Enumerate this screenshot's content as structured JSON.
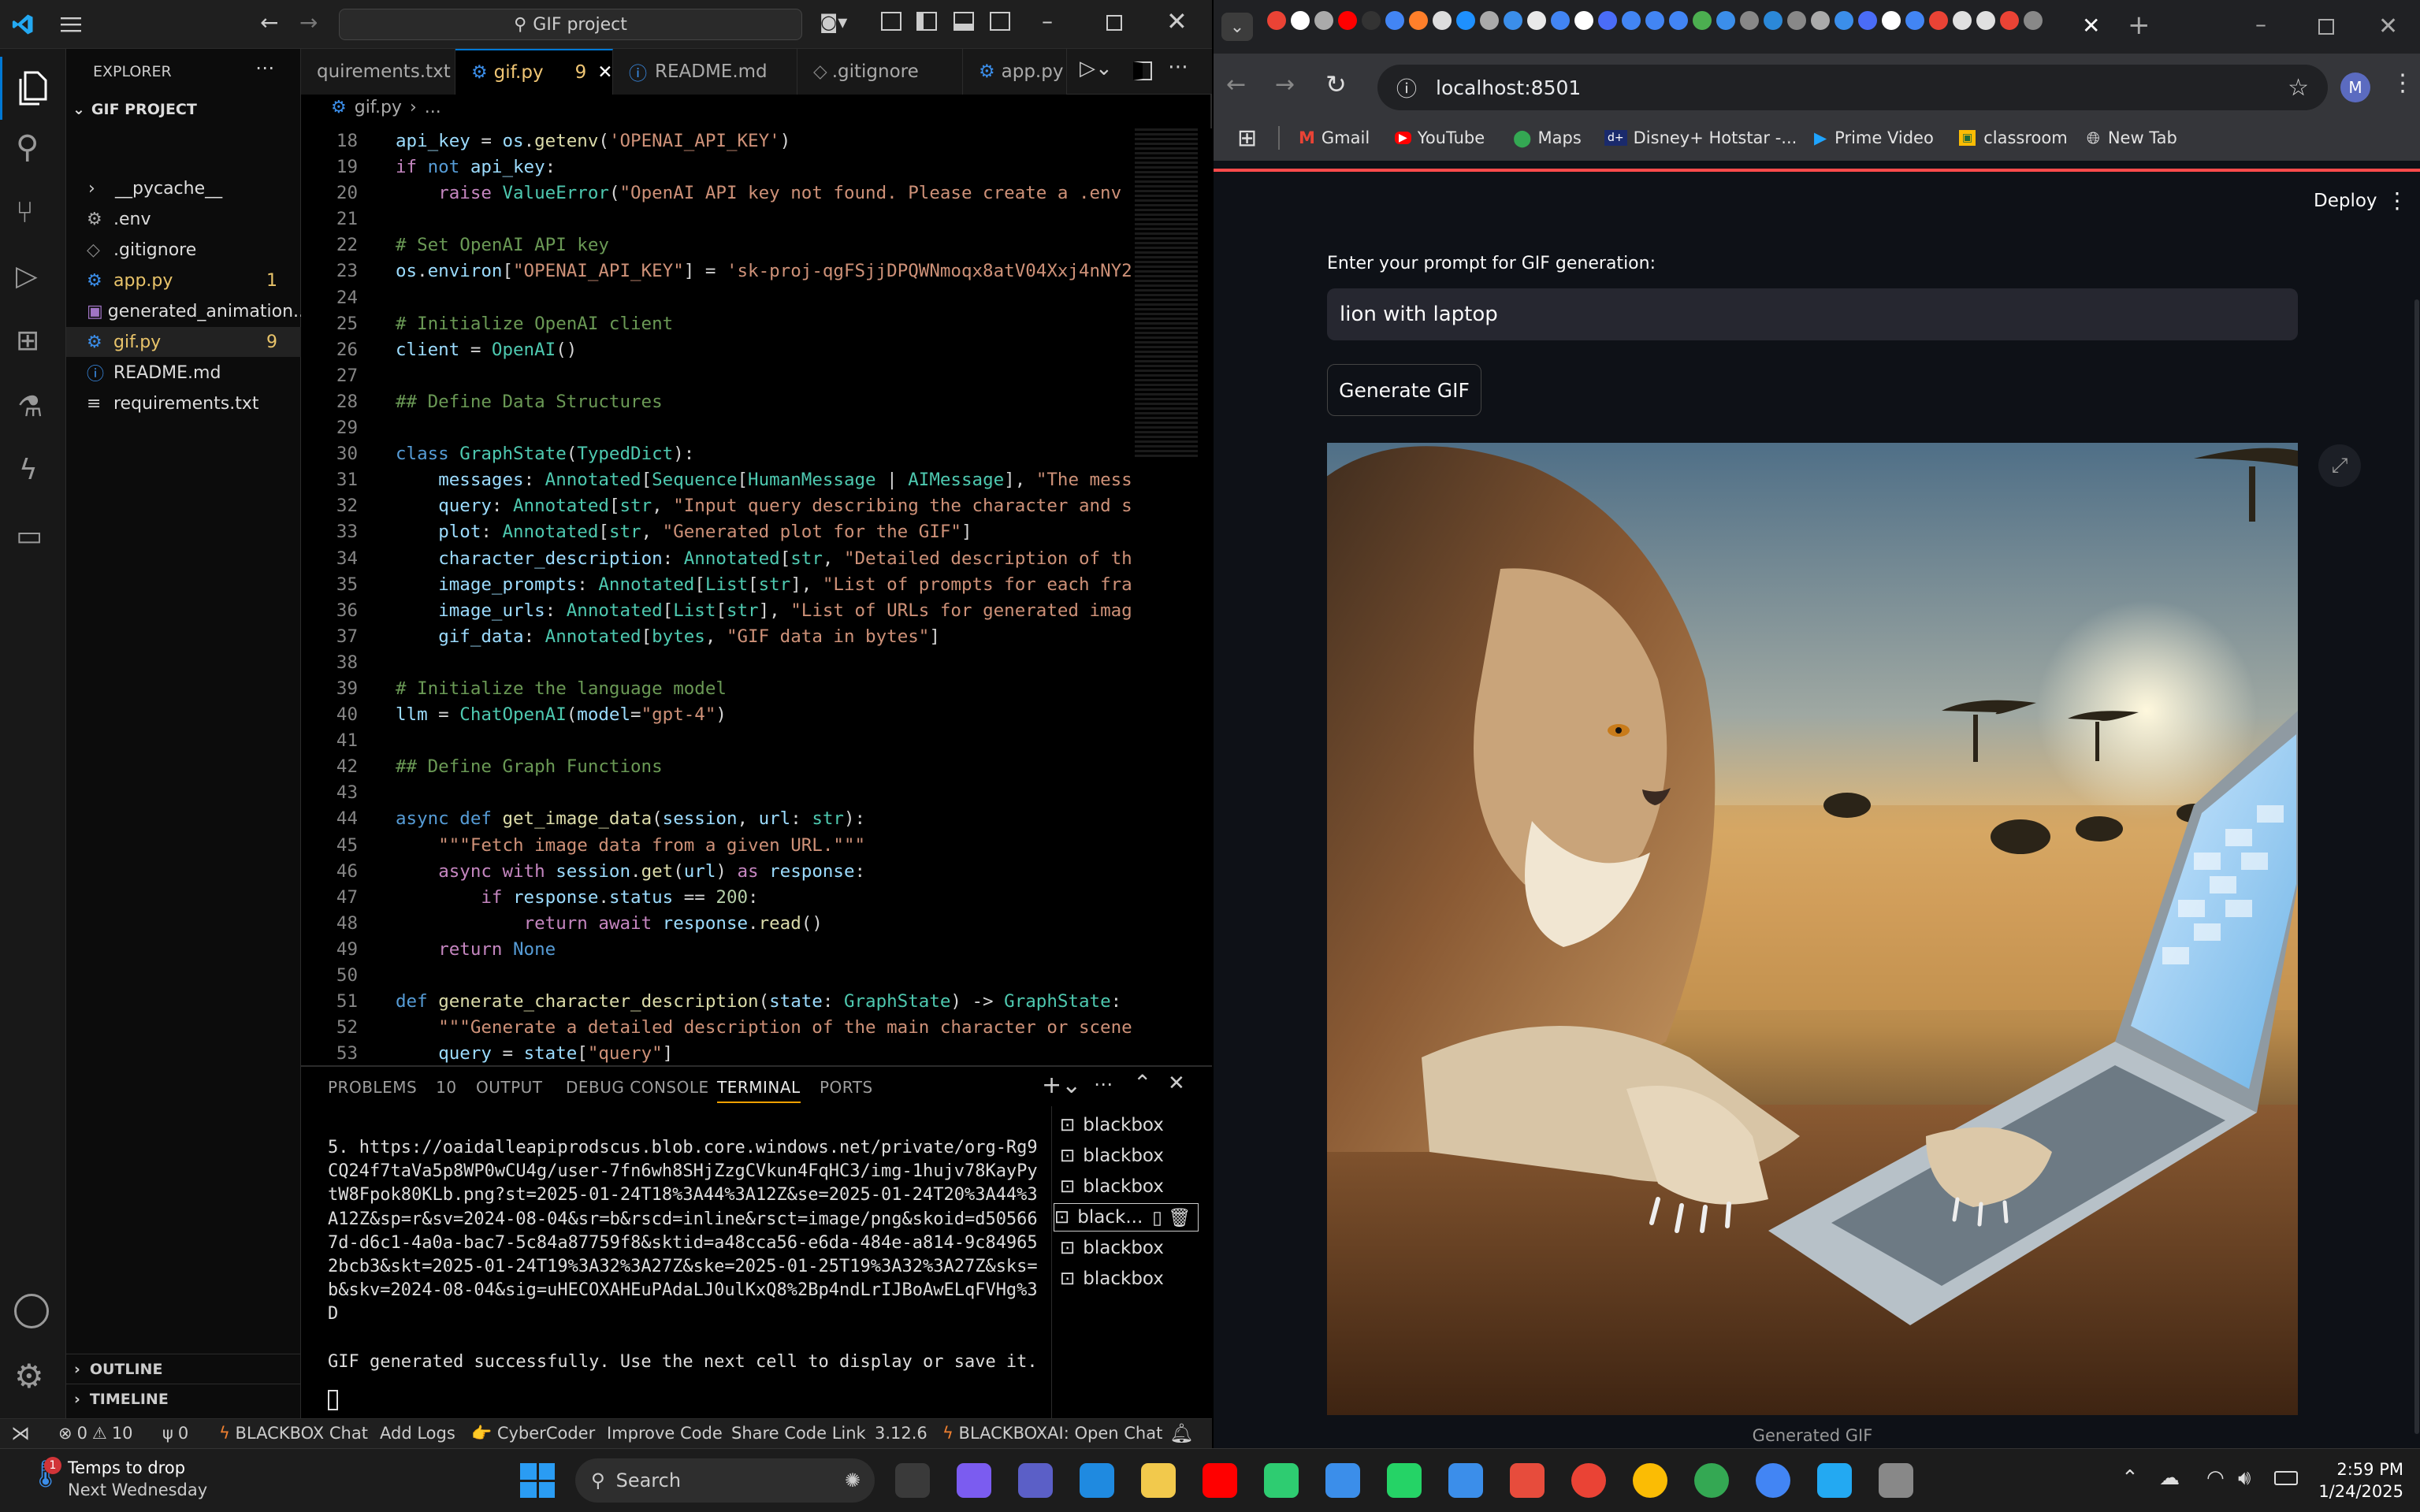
{
  "vscode": {
    "search_placeholder": "GIF project",
    "tabs": [
      {
        "label": "quirements.txt",
        "badge": "",
        "active": false
      },
      {
        "label": "gif.py",
        "badge": "9",
        "active": true
      },
      {
        "label": "README.md",
        "badge": "",
        "active": false
      },
      {
        "label": ".gitignore",
        "badge": "",
        "active": false
      },
      {
        "label": "app.py",
        "badge": "",
        "active": false
      }
    ],
    "breadcrumb": {
      "file": "gif.py",
      "rest": "..."
    },
    "explorer": {
      "title": "EXPLORER",
      "project": "GIF PROJECT",
      "items": [
        {
          "name": "__pycache__",
          "badge": "",
          "type": "folder"
        },
        {
          "name": ".env",
          "badge": "",
          "type": "gear"
        },
        {
          "name": ".gitignore",
          "badge": "",
          "type": "file"
        },
        {
          "name": "app.py",
          "badge": "1",
          "type": "py"
        },
        {
          "name": "generated_animation....",
          "badge": "",
          "type": "img"
        },
        {
          "name": "gif.py",
          "badge": "9",
          "type": "py"
        },
        {
          "name": "README.md",
          "badge": "",
          "type": "info"
        },
        {
          "name": "requirements.txt",
          "badge": "",
          "type": "txt"
        }
      ],
      "outline": "OUTLINE",
      "timeline": "TIMELINE"
    },
    "code_lines": [
      {
        "n": "18",
        "html": "<span class='var'>api_key</span> = <span class='var'>os</span>.<span class='fn'>getenv</span>(<span class='str'>'OPENAI_API_KEY'</span>)"
      },
      {
        "n": "19",
        "html": "<span class='ctl'>if</span> <span class='kw'>not</span> <span class='var'>api_key</span>:"
      },
      {
        "n": "20",
        "html": "    <span class='ctl'>raise</span> <span class='cls'>ValueError</span>(<span class='str'>\"OpenAI API key not found. Please create a .env</span>"
      },
      {
        "n": "21",
        "html": ""
      },
      {
        "n": "22",
        "html": "<span class='cm'># Set OpenAI API key</span>"
      },
      {
        "n": "23",
        "html": "<span class='var'>os</span>.<span class='var'>environ</span>[<span class='str'>\"OPENAI_API_KEY\"</span>] = <span class='str'>'sk-proj-qgFSjjDPQWNmoqx8atV04Xxj4nNY2</span>"
      },
      {
        "n": "24",
        "html": ""
      },
      {
        "n": "25",
        "html": "<span class='cm'># Initialize OpenAI client</span>"
      },
      {
        "n": "26",
        "html": "<span class='var'>client</span> = <span class='cls'>OpenAI</span>()"
      },
      {
        "n": "27",
        "html": ""
      },
      {
        "n": "28",
        "html": "<span class='cm'>## Define Data Structures</span>"
      },
      {
        "n": "29",
        "html": ""
      },
      {
        "n": "30",
        "html": "<span class='kw'>class</span> <span class='cls'>GraphState</span>(<span class='cls'>TypedDict</span>):"
      },
      {
        "n": "31",
        "html": "    <span class='var'>messages</span>: <span class='cls'>Annotated</span>[<span class='cls'>Sequence</span>[<span class='cls'>HumanMessage</span> | <span class='cls'>AIMessage</span>], <span class='str'>\"The mess</span>"
      },
      {
        "n": "32",
        "html": "    <span class='var'>query</span>: <span class='cls'>Annotated</span>[<span class='cls'>str</span>, <span class='str'>\"Input query describing the character and s</span>"
      },
      {
        "n": "33",
        "html": "    <span class='var'>plot</span>: <span class='cls'>Annotated</span>[<span class='cls'>str</span>, <span class='str'>\"Generated plot for the GIF\"</span>]"
      },
      {
        "n": "34",
        "html": "    <span class='var'>character_description</span>: <span class='cls'>Annotated</span>[<span class='cls'>str</span>, <span class='str'>\"Detailed description of th</span>"
      },
      {
        "n": "35",
        "html": "    <span class='var'>image_prompts</span>: <span class='cls'>Annotated</span>[<span class='cls'>List</span>[<span class='cls'>str</span>], <span class='str'>\"List of prompts for each fra</span>"
      },
      {
        "n": "36",
        "html": "    <span class='var'>image_urls</span>: <span class='cls'>Annotated</span>[<span class='cls'>List</span>[<span class='cls'>str</span>], <span class='str'>\"List of URLs for generated imag</span>"
      },
      {
        "n": "37",
        "html": "    <span class='var'>gif_data</span>: <span class='cls'>Annotated</span>[<span class='cls'>bytes</span>, <span class='str'>\"GIF data in bytes\"</span>]"
      },
      {
        "n": "38",
        "html": ""
      },
      {
        "n": "39",
        "html": "<span class='cm'># Initialize the language model</span>"
      },
      {
        "n": "40",
        "html": "<span class='var'>llm</span> = <span class='cls'>ChatOpenAI</span>(<span class='var'>model</span>=<span class='str'>\"gpt-4\"</span>)"
      },
      {
        "n": "41",
        "html": ""
      },
      {
        "n": "42",
        "html": "<span class='cm'>## Define Graph Functions</span>"
      },
      {
        "n": "43",
        "html": ""
      },
      {
        "n": "44",
        "html": "<span class='kw'>async</span> <span class='kw'>def</span> <span class='fn'>get_image_data</span>(<span class='var'>session</span>, <span class='var'>url</span>: <span class='cls'>str</span>):"
      },
      {
        "n": "45",
        "html": "    <span class='str'>\"\"\"Fetch image data from a given URL.\"\"\"</span>"
      },
      {
        "n": "46",
        "html": "    <span class='ctl'>async</span> <span class='ctl'>with</span> <span class='var'>session</span>.<span class='fn'>get</span>(<span class='var'>url</span>) <span class='ctl'>as</span> <span class='var'>response</span>:"
      },
      {
        "n": "47",
        "html": "        <span class='ctl'>if</span> <span class='var'>response</span>.<span class='var'>status</span> == <span class='num'>200</span>:"
      },
      {
        "n": "48",
        "html": "            <span class='ctl'>return</span> <span class='ctl'>await</span> <span class='var'>response</span>.<span class='fn'>read</span>()"
      },
      {
        "n": "49",
        "html": "    <span class='ctl'>return</span> <span class='kw'>None</span>"
      },
      {
        "n": "50",
        "html": ""
      },
      {
        "n": "51",
        "html": "<span class='kw'>def</span> <span class='fn'>generate_character_description</span>(<span class='var'>state</span>: <span class='cls'>GraphState</span>) -> <span class='cls'>GraphState</span>:"
      },
      {
        "n": "52",
        "html": "    <span class='str'>\"\"\"Generate a detailed description of the main character or scene</span>"
      },
      {
        "n": "53",
        "html": "    <span class='var'>query</span> = <span class='var'>state</span>[<span class='str'>\"query\"</span>]"
      }
    ],
    "panel": {
      "tabs": [
        "PROBLEMS",
        "OUTPUT",
        "DEBUG CONSOLE",
        "TERMINAL",
        "PORTS"
      ],
      "problems_count": "10",
      "terminal_lines": [
        "5. https://oaidalleapiprodscus.blob.core.windows.net/private/org-Rg9",
        "CQ24f7taVa5p8WP0wCU4g/user-7fn6wh8SHjZzgCVkun4FqHC3/img-1hujv78KayPy",
        "tW8Fpok80KLb.png?st=2025-01-24T18%3A44%3A12Z&se=2025-01-24T20%3A44%3",
        "A12Z&sp=r&sv=2024-08-04&sr=b&rscd=inline&rsct=image/png&skoid=d50566",
        "7d-d6c1-4a0a-bac7-5c84a87759f8&sktid=a48cca56-e6da-484e-a814-9c84965",
        "2bcb3&skt=2025-01-24T19%3A32%3A27Z&ske=2025-01-25T19%3A32%3A27Z&sks=",
        "b&skv=2024-08-04&sig=uHECOXAHEuPAdaLJ0ulKxQ8%2Bp4ndLrIJBoAwELqFVHg%3",
        "D",
        "",
        "GIF generated successfully. Use the next cell to display or save it."
      ],
      "terminals": [
        "blackbox",
        "blackbox",
        "blackbox",
        "black...",
        "blackbox",
        "blackbox"
      ]
    },
    "status": {
      "errors": "0",
      "warnings": "10",
      "ports": "0",
      "items": [
        "BLACKBOX Chat",
        "Add Logs",
        "CyberCoder",
        "Improve Code",
        "Share Code Link",
        "3.12.6",
        "BLACKBOXAI: Open Chat"
      ]
    }
  },
  "browser": {
    "url": "localhost:8501",
    "avatar": "M",
    "bookmarks": [
      "Gmail",
      "YouTube",
      "Maps",
      "Disney+ Hotstar -...",
      "Prime Video",
      "classroom",
      "New Tab"
    ],
    "deploy_label": "Deploy",
    "prompt_label": "Enter your prompt for GIF generation:",
    "prompt_value": "lion with laptop",
    "button_label": "Generate GIF",
    "caption": "Generated GIF"
  },
  "taskbar": {
    "weather_line1": "Temps to drop",
    "weather_line2": "Next Wednesday",
    "weather_badge": "1",
    "search_placeholder": "Search",
    "time": "2:59 PM",
    "date": "1/24/2025"
  },
  "colors": {
    "accent": "#0078d4",
    "terminal_active": "#e7e7e7",
    "chrome_bg": "#0e1117"
  }
}
